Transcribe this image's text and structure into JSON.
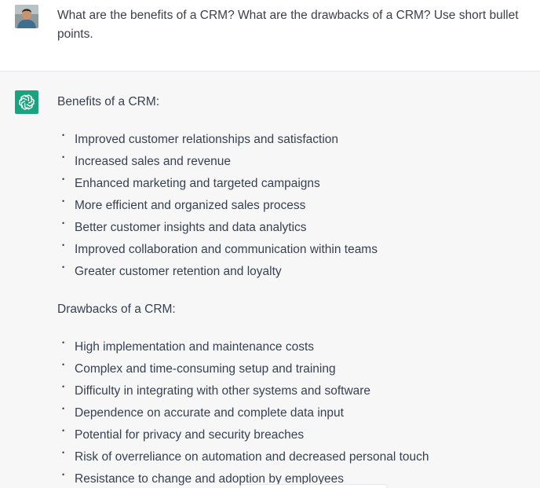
{
  "user_message": {
    "avatar": "user-photo-avatar",
    "text": "What are the benefits of a CRM?  What are the drawbacks of a CRM?  Use short bullet points."
  },
  "assistant_message": {
    "logo": "openai-logo-icon",
    "brand_color": "#19a37f",
    "benefits_heading": "Benefits of a CRM:",
    "benefits": [
      "Improved customer relationships and satisfaction",
      "Increased sales and revenue",
      "Enhanced marketing and targeted campaigns",
      "More efficient and organized sales process",
      "Better customer insights and data analytics",
      "Improved collaboration and communication within teams",
      "Greater customer retention and loyalty"
    ],
    "drawbacks_heading": "Drawbacks of a CRM:",
    "drawbacks": [
      "High implementation and maintenance costs",
      "Complex and time-consuming setup and training",
      "Difficulty in integrating with other systems and software",
      "Dependence on accurate and complete data input",
      "Potential for privacy and security breaches",
      "Risk of overreliance on automation and decreased personal touch",
      "Resistance to change and adoption by employees"
    ]
  }
}
